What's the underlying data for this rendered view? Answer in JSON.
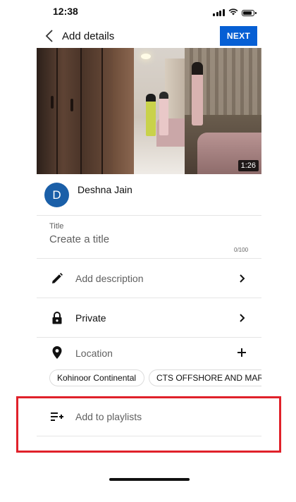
{
  "status_bar": {
    "time": "12:38"
  },
  "header": {
    "title": "Add details",
    "next_label": "NEXT"
  },
  "video": {
    "duration": "1:26"
  },
  "account": {
    "avatar_letter": "D",
    "name": "Deshna Jain",
    "avatar_color": "#1a5fa8"
  },
  "title_field": {
    "label": "Title",
    "placeholder": "Create a title",
    "counter": "0/100"
  },
  "rows": {
    "description": {
      "label": "Add description",
      "icon": "pencil-icon"
    },
    "visibility": {
      "label": "Private",
      "icon": "lock-icon"
    },
    "location": {
      "label": "Location",
      "icon": "location-pin-icon"
    },
    "playlists": {
      "label": "Add to playlists",
      "icon": "playlist-add-icon"
    }
  },
  "location_suggestions": [
    "Kohinoor Continental",
    "CTS OFFSHORE AND MAR…"
  ],
  "colors": {
    "accent": "#065fd4",
    "highlight": "#e0212a"
  }
}
